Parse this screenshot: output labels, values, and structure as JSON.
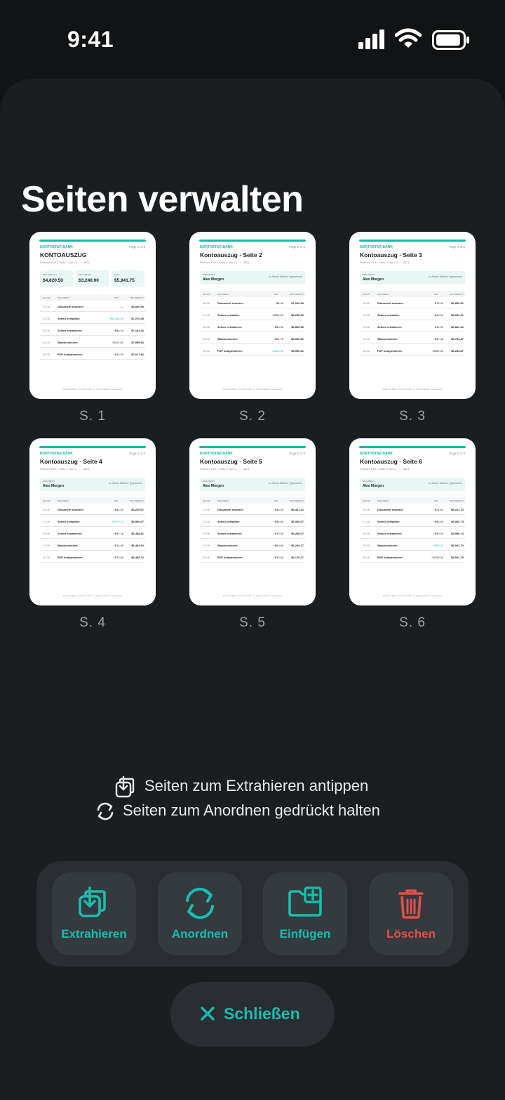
{
  "status": {
    "time": "9:41"
  },
  "title": "Seiten verwalten",
  "pages": [
    {
      "label": "S. 1",
      "kind": "summary",
      "bank": "NORTHSTAR BANK",
      "page_of": "Page 1 of 6",
      "title": "KONTOAUSZUG",
      "subtitle": "Probuze PDF  |  Seite 1 von 6  |  ····· 4821",
      "cards": [
        {
          "k": "PDF BERICHT",
          "v": "$4,820.50"
        },
        {
          "k": "PRO SEITEN",
          "v": "$3,240.00"
        },
        {
          "k": "SUM",
          "v": "$5,941.75"
        }
      ],
      "thead": [
        "DATUM",
        "DOKUMENT",
        "PDF",
        "PDF BERICHT"
      ],
      "rows": [
        {
          "d": "01.06",
          "desc": "Dokument scannen",
          "amt": "—",
          "pos": false,
          "bal": "$4,820.50"
        },
        {
          "d": "03.06",
          "desc": "Seiten verwalten",
          "amt": "+$2,450.00",
          "pos": true,
          "bal": "$7,270.50"
        },
        {
          "d": "03.06",
          "desc": "Seiten extrahieren",
          "amt": "−$86.24",
          "pos": false,
          "bal": "$7,184.26"
        },
        {
          "d": "04.06",
          "desc": "Wasserzeichen",
          "amt": "−$124.60",
          "pos": false,
          "bal": "$7,059.66"
        },
        {
          "d": "05.06",
          "desc": "PDF komprimieren",
          "amt": "−$42.00",
          "pos": false,
          "bal": "$7,017.66"
        }
      ],
      "footer": "Northstar Bank  •  Probuze PDF  •  in „Meine Dateien“ gespeichert"
    },
    {
      "label": "S. 2",
      "kind": "detail",
      "bank": "NORTHSTAR BANK",
      "page_of": "Page 2 of 6",
      "title": "Kontoauszug · Seite 2",
      "subtitle": "Probuze PDF  |  Seite 2 von 6  |  ····· 4821",
      "acct": {
        "k": "DOKUMENT",
        "v": "Alex Morgen",
        "r": "in „Meine Dateien“ gespeichert"
      },
      "thead": [
        "DATUM",
        "DOKUMENT",
        "PDF",
        "PDF BERICHT"
      ],
      "rows": [
        {
          "d": "06.06",
          "desc": "Dokument scannen",
          "amt": "−$8.40",
          "pos": false,
          "bal": "$7,009.26"
        },
        {
          "d": "07.06",
          "desc": "Seiten verwalten",
          "amt": "−$350.00",
          "pos": false,
          "bal": "$6,659.26"
        },
        {
          "d": "08.06",
          "desc": "Seiten extrahieren",
          "amt": "−$63.90",
          "pos": false,
          "bal": "$6,595.36"
        },
        {
          "d": "09.06",
          "desc": "Wasserzeichen",
          "amt": "−$64.75",
          "pos": false,
          "bal": "$6,530.61"
        },
        {
          "d": "10.06",
          "desc": "PDF komprimieren",
          "amt": "+$400.00",
          "pos": true,
          "bal": "$6,930.61"
        }
      ],
      "footer": "Northstar Bank  •  Probuze PDF  •  in „Meine Dateien“ gespeichert"
    },
    {
      "label": "S. 3",
      "kind": "detail",
      "bank": "NORTHSTAR BANK",
      "page_of": "Page 3 of 6",
      "title": "Kontoauszug · Seite 3",
      "subtitle": "Probuze PDF  |  Seite 3 von 6  |  ····· 4821",
      "acct": {
        "k": "DOKUMENT",
        "v": "Alex Morgen",
        "r": "in „Meine Dateien“ gespeichert"
      },
      "thead": [
        "DATUM",
        "DOKUMENT",
        "PDF",
        "PDF BERICHT"
      ],
      "rows": [
        {
          "d": "11.06",
          "desc": "Dokument scannen",
          "amt": "−$78.00",
          "pos": false,
          "bal": "$6,852.61"
        },
        {
          "d": "12.06",
          "desc": "Seiten verwalten",
          "amt": "−$18.30",
          "pos": false,
          "bal": "$6,834.31"
        },
        {
          "d": "13.06",
          "desc": "Seiten extrahieren",
          "amt": "−$11.99",
          "pos": false,
          "bal": "$6,822.32"
        },
        {
          "d": "14.06",
          "desc": "Wasserzeichen",
          "amt": "−$37.45",
          "pos": false,
          "bal": "$6,784.87"
        },
        {
          "d": "15.06",
          "desc": "PDF komprimieren",
          "amt": "−$500.00",
          "pos": false,
          "bal": "$6,284.87"
        }
      ],
      "footer": "Northstar Bank  •  Probuze PDF  •  in „Meine Dateien“ gespeichert"
    },
    {
      "label": "S. 4",
      "kind": "detail",
      "bank": "NORTHSTAR BANK",
      "page_of": "Page 4 of 6",
      "title": "Kontoauszug · Seite 4",
      "subtitle": "Probuze PDF  |  Seite 4 von 6  |  ····· 4821",
      "acct": {
        "k": "DOKUMENT",
        "v": "Alex Morgen",
        "r": "in „Meine Dateien“ gespeichert"
      },
      "thead": [
        "DATUM",
        "DOKUMENT",
        "PDF",
        "PDF BERICHT"
      ],
      "rows": [
        {
          "d": "16.06",
          "desc": "Dokument scannen",
          "amt": "−$64.20",
          "pos": false,
          "bal": "$6,220.67"
        },
        {
          "d": "17.06",
          "desc": "Seiten verwalten",
          "amt": "+$370.00",
          "pos": true,
          "bal": "$6,590.67"
        },
        {
          "d": "18.06",
          "desc": "Seiten extrahieren",
          "amt": "−$92.16",
          "pos": false,
          "bal": "$6,498.51"
        },
        {
          "d": "19.06",
          "desc": "Wasserzeichen",
          "amt": "−$13.99",
          "pos": false,
          "bal": "$6,484.52"
        },
        {
          "d": "20.06",
          "desc": "PDF komprimieren",
          "amt": "−$75.80",
          "pos": false,
          "bal": "$6,408.72"
        }
      ],
      "footer": "Northstar Bank  •  Probuze PDF  •  in „Meine Dateien“ gespeichert"
    },
    {
      "label": "S. 5",
      "kind": "detail",
      "bank": "NORTHSTAR BANK",
      "page_of": "Page 5 of 6",
      "title": "Kontoauszug · Seite 5",
      "subtitle": "Probuze PDF  |  Seite 5 von 6  |  ····· 4821",
      "acct": {
        "k": "DOKUMENT",
        "v": "Alex Morgen",
        "r": "in „Meine Dateien“ gespeichert"
      },
      "thead": [
        "DATUM",
        "DOKUMENT",
        "PDF",
        "PDF BERICHT"
      ],
      "rows": [
        {
          "d": "21.06",
          "desc": "Dokument scannen",
          "amt": "−$48.25",
          "pos": false,
          "bal": "$6,361.41"
        },
        {
          "d": "22.06",
          "desc": "Seiten verwalten",
          "amt": "−$56.80",
          "pos": false,
          "bal": "$6,305.07"
        },
        {
          "d": "23.06",
          "desc": "Seiten extrahieren",
          "amt": "−$19.00",
          "pos": false,
          "bal": "$6,286.07"
        },
        {
          "d": "24.06",
          "desc": "Wasserzeichen",
          "amt": "−$69.90",
          "pos": false,
          "bal": "$6,206.17"
        },
        {
          "d": "25.06",
          "desc": "PDF komprimieren",
          "amt": "−$30.00",
          "pos": false,
          "bal": "$6,176.17"
        }
      ],
      "footer": "Northstar Bank  •  Probuze PDF  •  in „Meine Dateien“ gespeichert"
    },
    {
      "label": "S. 6",
      "kind": "detail",
      "bank": "NORTHSTAR BANK",
      "page_of": "Page 6 of 6",
      "title": "Kontoauszug · Seite 6",
      "subtitle": "Probuze PDF  |  Seite 6 von 6  |  ····· 4821",
      "acct": {
        "k": "DOKUMENT",
        "v": "Alex Morgen",
        "r": "in „Meine Dateien“ gespeichert"
      },
      "thead": [
        "DATUM",
        "DOKUMENT",
        "PDF",
        "PDF BERICHT"
      ],
      "rows": [
        {
          "d": "26.06",
          "desc": "Dokument scannen",
          "amt": "−$74.92",
          "pos": false,
          "bal": "$6,101.73"
        },
        {
          "d": "27.06",
          "desc": "Seiten verwalten",
          "amt": "−$95.00",
          "pos": false,
          "bal": "$6,006.73"
        },
        {
          "d": "28.06",
          "desc": "Seiten extrahieren",
          "amt": "−$50.00",
          "pos": false,
          "bal": "$5,996.73"
        },
        {
          "d": "29.06",
          "desc": "Wasserzeichen",
          "amt": "+$95.00",
          "pos": true,
          "bal": "$6,091.73"
        },
        {
          "d": "30.06",
          "desc": "PDF komprimieren",
          "amt": "−$150.00",
          "pos": false,
          "bal": "$5,941.75"
        }
      ],
      "footer": "Northstar Bank  •  Probuze PDF  •  in „Meine Dateien“ gespeichert"
    }
  ],
  "hints": {
    "extract": "Seiten zum Extrahieren antippen",
    "reorder": "Seiten zum Anordnen gedrückt halten"
  },
  "actions": {
    "extract": "Extrahieren",
    "reorder": "Anordnen",
    "insert": "Einfügen",
    "delete": "Löschen"
  },
  "close": "Schließen",
  "colors": {
    "accent": "#1bbcad",
    "danger": "#e0504d",
    "background": "#111315",
    "sheet": "#1b1e21"
  }
}
